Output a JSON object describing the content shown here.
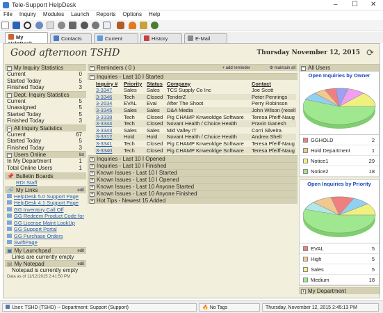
{
  "window": {
    "title": "Tele-Support HelpDesk",
    "minimize": "–",
    "maximize": "☐",
    "close": "✕"
  },
  "menu": [
    "File",
    "Inquiry",
    "Modules",
    "Launch",
    "Reports",
    "Options",
    "Help"
  ],
  "tabs": [
    {
      "label": "My HelpDesk",
      "icon": "home-icon",
      "color": "#d06030",
      "active": true
    },
    {
      "label": "Contacts",
      "icon": "contacts-icon",
      "color": "#4a7bc8",
      "active": false
    },
    {
      "label": "Current",
      "icon": "current-icon",
      "color": "#5c9cd8",
      "active": false
    },
    {
      "label": "History",
      "icon": "history-icon",
      "color": "#c84040",
      "active": false
    },
    {
      "label": "E-Mail",
      "icon": "email-icon",
      "color": "#888888",
      "active": false
    }
  ],
  "header": {
    "greeting": "Good afternoon TSHD",
    "date": "Thursday November 12, 2015"
  },
  "left": {
    "my_stats": {
      "title": "My Inquiry Statistics",
      "rows": [
        {
          "label": "Current",
          "value": "0"
        },
        {
          "label": "Started Today",
          "value": "5"
        },
        {
          "label": "Finished Today",
          "value": "3"
        }
      ]
    },
    "dept_stats": {
      "title": "Dept. Inquiry Statistics",
      "rows": [
        {
          "label": "Current",
          "value": "5"
        },
        {
          "label": "Unassigned",
          "value": "5"
        },
        {
          "label": "Started Today",
          "value": "5"
        },
        {
          "label": "Finished Today",
          "value": "3"
        }
      ]
    },
    "all_stats": {
      "title": "All Inquiry Statistics",
      "rows": [
        {
          "label": "Current",
          "value": "67"
        },
        {
          "label": "Started Today",
          "value": "5"
        },
        {
          "label": "Finished Today",
          "value": "3"
        }
      ]
    },
    "users_online": {
      "title": "Users Online",
      "link": "list",
      "rows": [
        {
          "label": "In My Department",
          "value": "1"
        },
        {
          "label": "Total Online Users",
          "value": "1"
        }
      ]
    },
    "bulletin": {
      "title": "Bulletin Boards",
      "items": [
        "RDI Staff"
      ]
    },
    "my_links": {
      "title": "My Links",
      "edit": "edit",
      "items": [
        "HelpDesk 5.0 Support Page",
        "HelpDesk 4.1 Support Page",
        "GG Inventory Call Off",
        "GG Redeem Product Code for",
        "GG License Maint LookUp",
        "GG Support Portal",
        "GG Purchase Orders",
        "SwiftPage"
      ]
    },
    "launchpad": {
      "title": "My Launchpad",
      "edit": "edit",
      "text": "Links are currently empty"
    },
    "notepad": {
      "title": "My Notepad",
      "edit": "edit",
      "text": "Notepad is currently empty"
    },
    "data_stamp": "Data as of 11/12/2015 2:41:50 PM"
  },
  "center": {
    "reminders": {
      "title": "Reminders ( 0 )",
      "add": "add reminder",
      "maintain": "maintain all"
    },
    "inquiries": {
      "title": "Inquiries - Last 10 I Started",
      "columns": [
        "Inquiry #",
        "Priority",
        "Status",
        "Company",
        "Contact"
      ],
      "rows": [
        [
          "3-3347",
          "Sales",
          "Sales",
          "TCS Supply Co Inc",
          "Joe Scott"
        ],
        [
          "3-3346",
          "Tech",
          "Closed",
          "TenderZ",
          "Peter Pennings"
        ],
        [
          "3-2634",
          "EVAL",
          "Eval",
          "After The Shoot",
          "Perry Robinson"
        ],
        [
          "3-3345",
          "Sales",
          "Sales",
          "D&A Media",
          "John Wilson (resell"
        ],
        [
          "3-3338",
          "Tech",
          "Closed",
          "Pig CHAMP Knweoldge Software",
          "Teresa Pfeiff-Naug"
        ],
        [
          "3-3344",
          "Tech",
          "Closed",
          "Novant Health / Choice Health",
          "Pravin Ganesh"
        ],
        [
          "3-3343",
          "Sales",
          "Sales",
          "Mid Valley IT",
          "Corri Silveira"
        ],
        [
          "3-3312",
          "Hold",
          "Hold",
          "Novant Health / Choice Health",
          "Andrea Shell"
        ],
        [
          "3-3341",
          "Tech",
          "Closed",
          "Pig CHAMP Knweoldge Software",
          "Teresa Pfeiff-Naug"
        ],
        [
          "3-3340",
          "Tech",
          "Closed",
          "Pig CHAMP Knweoldge Software",
          "Teresa Pfeiff-Naug"
        ]
      ]
    },
    "collapsed": [
      "Inquiries - Last 10 I Opened",
      "Inquiries - Last 10 I Finished",
      "Known Issues - Last 10 I Started",
      "Known Issues - Last 10 I Opened",
      "Known Issues - Last 10 Anyone Started",
      "Known Issues - Last 10 Anyone Finished",
      "Hot Tips - Newest 15 Added"
    ]
  },
  "right": {
    "title": "All Users",
    "owner_chart": {
      "title": "Open Inquiries by Owner",
      "legend": [
        {
          "label": "GGHOLD",
          "value": "2",
          "color": "#f08080"
        },
        {
          "label": "Hold Department",
          "value": "1",
          "color": "#f0c890"
        },
        {
          "label": "Notice1",
          "value": "29",
          "color": "#f0f080"
        },
        {
          "label": "Notice2",
          "value": "18",
          "color": "#a0e890"
        }
      ]
    },
    "priority_chart": {
      "title": "Open Inquiries by Priority",
      "legend": [
        {
          "label": "EVAL",
          "value": "5",
          "color": "#f08080"
        },
        {
          "label": "High",
          "value": "5",
          "color": "#f0c890"
        },
        {
          "label": "Sales",
          "value": "5",
          "color": "#f0f080"
        },
        {
          "label": "Medium",
          "value": "18",
          "color": "#a0e890"
        }
      ]
    },
    "my_department": "My Department"
  },
  "statusbar": {
    "user": "User: TSHD (TSHD) -- Department: Support (Support)",
    "tags": "No Tags",
    "datetime": "Thursday, November 12, 2015  2:45:13 PM"
  }
}
